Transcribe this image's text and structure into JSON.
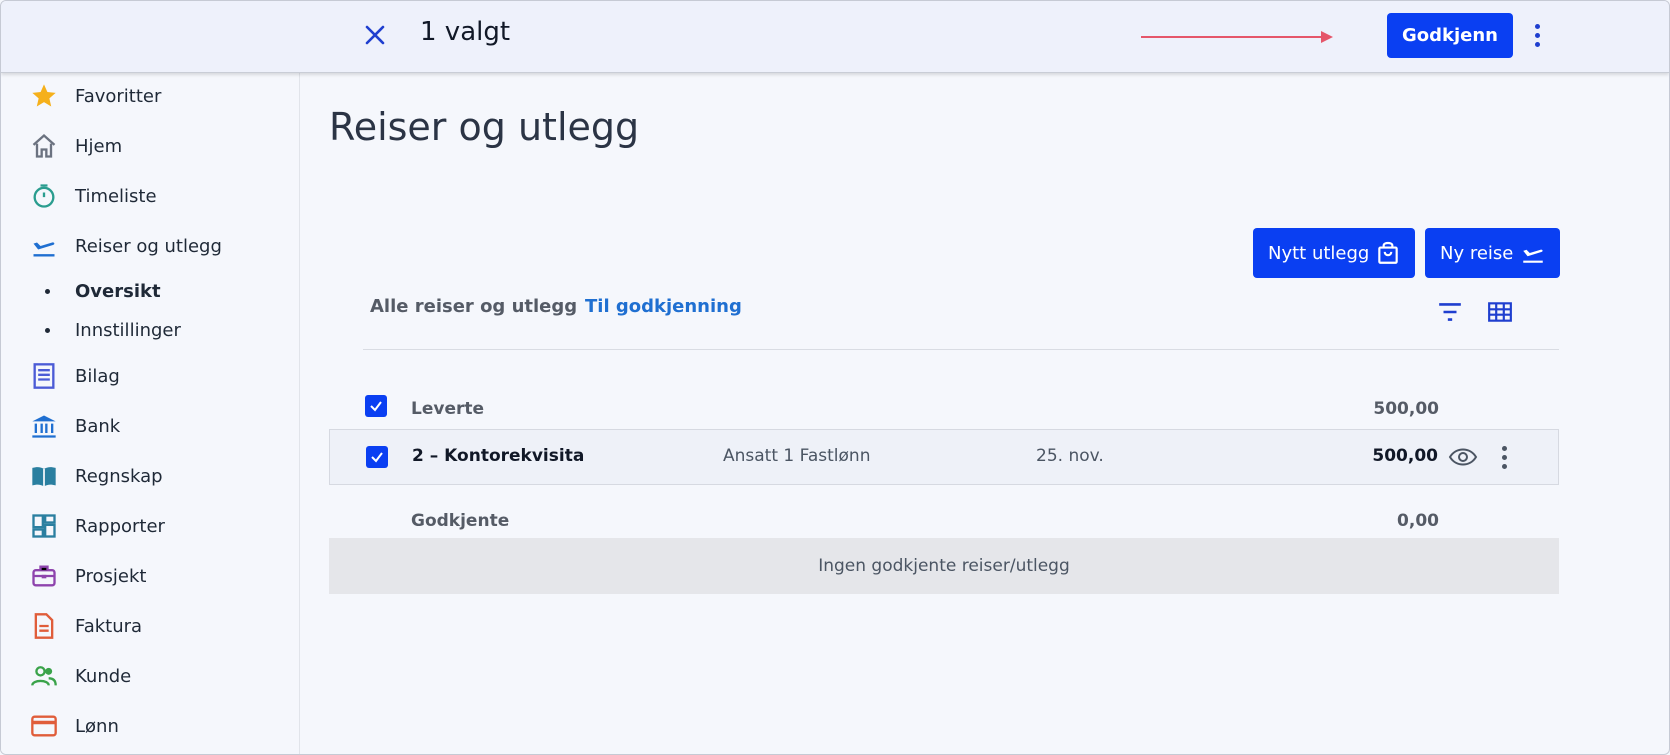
{
  "topbar": {
    "selected_text": "1 valgt",
    "approve_label": "Godkjenn"
  },
  "sidebar": {
    "items": [
      {
        "label": "Favoritter",
        "icon": "star-icon",
        "color": "#f5b01b"
      },
      {
        "label": "Hjem",
        "icon": "home-icon",
        "color": "#6b7280"
      },
      {
        "label": "Timeliste",
        "icon": "stopwatch-icon",
        "color": "#2a9d8f"
      },
      {
        "label": "Reiser og utlegg",
        "icon": "airplane-takeoff-icon",
        "color": "#1f6fd1"
      },
      {
        "label": "Bilag",
        "icon": "receipt-icon",
        "color": "#4b5bd6"
      },
      {
        "label": "Bank",
        "icon": "bank-icon",
        "color": "#1f6fd1"
      },
      {
        "label": "Regnskap",
        "icon": "book-icon",
        "color": "#2a7fa0"
      },
      {
        "label": "Rapporter",
        "icon": "dashboard-icon",
        "color": "#2a7fa0"
      },
      {
        "label": "Prosjekt",
        "icon": "briefcase-icon",
        "color": "#8e44ad"
      },
      {
        "label": "Faktura",
        "icon": "document-icon",
        "color": "#e05d3a"
      },
      {
        "label": "Kunde",
        "icon": "people-icon",
        "color": "#3aa34a"
      },
      {
        "label": "Lønn",
        "icon": "card-icon",
        "color": "#e05d3a"
      }
    ],
    "subitems": [
      {
        "label": "Oversikt",
        "active": true
      },
      {
        "label": "Innstillinger",
        "active": false
      }
    ]
  },
  "main": {
    "title": "Reiser og utlegg",
    "new_expense_label": "Nytt utlegg",
    "new_trip_label": "Ny reise",
    "tabs": [
      {
        "label": "Alle reiser og utlegg",
        "active": false
      },
      {
        "label": "Til godkjenning",
        "active": true
      }
    ],
    "delivered": {
      "label": "Leverte",
      "amount": "500,00"
    },
    "row": {
      "title": "2 – Kontorekvisita",
      "person": "Ansatt 1 Fastlønn",
      "date": "25. nov.",
      "amount": "500,00"
    },
    "approved": {
      "label": "Godkjente",
      "amount": "0,00",
      "empty_text": "Ingen godkjente reiser/utlegg"
    }
  },
  "colors": {
    "accent": "#0a3ff2",
    "tab_active": "#1f6fd1",
    "arrow": "#e5566a"
  }
}
